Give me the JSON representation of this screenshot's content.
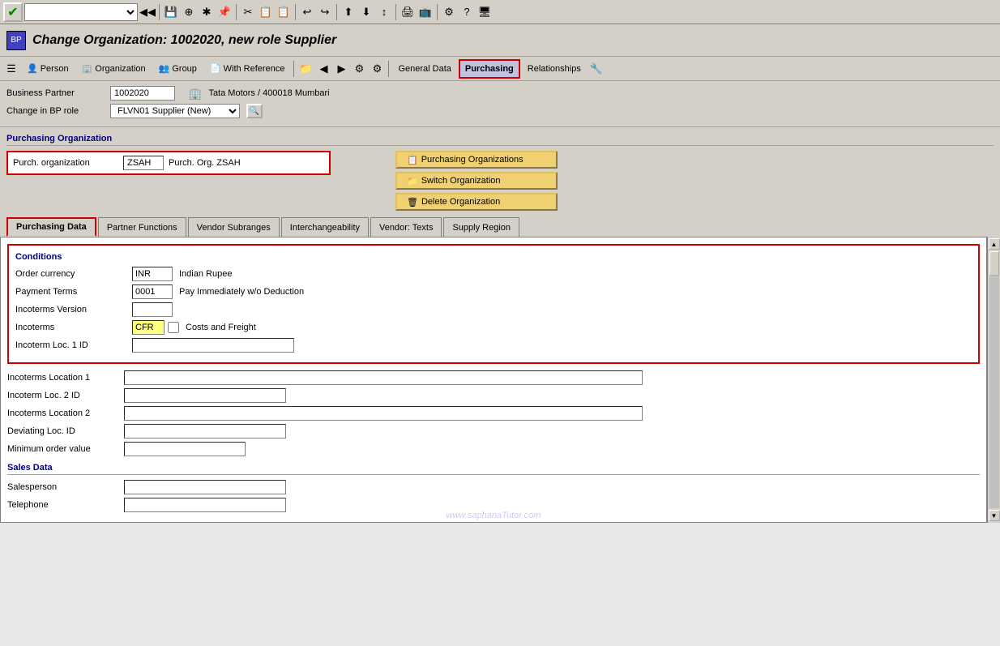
{
  "toolbar": {
    "select_placeholder": "",
    "icons": [
      "◀◀",
      "💾",
      "◀",
      "▶",
      "⊕",
      "✂",
      "📋",
      "📋",
      "↩",
      "↪",
      "📎",
      "📎",
      "⬆",
      "⬇",
      "↕",
      "🖨",
      "📺",
      "⚙",
      "?",
      "🖥"
    ]
  },
  "title": {
    "text": "Change Organization: 1002020, new role Supplier",
    "icon": "BP"
  },
  "nav": {
    "buttons": [
      {
        "label": "Person",
        "icon": "👤",
        "active": false
      },
      {
        "label": "Organization",
        "icon": "🏢",
        "active": false
      },
      {
        "label": "Group",
        "icon": "👥",
        "active": false
      },
      {
        "label": "With Reference",
        "icon": "📄",
        "active": false
      },
      {
        "label": "",
        "icon": "📁",
        "active": false
      },
      {
        "label": "",
        "icon": "◀",
        "active": false
      },
      {
        "label": "",
        "icon": "▶",
        "active": false
      },
      {
        "label": "",
        "icon": "⚙",
        "active": false
      },
      {
        "label": "",
        "icon": "⚙",
        "active": false
      },
      {
        "label": "General Data",
        "icon": "",
        "active": false
      },
      {
        "label": "Purchasing",
        "icon": "",
        "active": true
      },
      {
        "label": "Relationships",
        "icon": "",
        "active": false
      },
      {
        "label": "",
        "icon": "🔧",
        "active": false
      }
    ]
  },
  "business_partner": {
    "label": "Business Partner",
    "value": "1002020",
    "company_icon": "🏢",
    "company_name": "Tata Motors / 400018 Mumbari",
    "change_in_bp_role_label": "Change in BP role",
    "role_value": "FLVN01 Supplier (New)",
    "lookup_icon": "🔍"
  },
  "purchasing_organization": {
    "section_title": "Purchasing Organization",
    "field_label": "Purch. organization",
    "code": "ZSAH",
    "description": "Purch. Org. ZSAH",
    "buttons": [
      {
        "label": "Purchasing Organizations",
        "icon": "📋"
      },
      {
        "label": "Switch Organization",
        "icon": "📁"
      },
      {
        "label": "Delete Organization",
        "icon": "🗑"
      }
    ]
  },
  "tabs": [
    {
      "label": "Purchasing Data",
      "active": true
    },
    {
      "label": "Partner Functions",
      "active": false
    },
    {
      "label": "Vendor Subranges",
      "active": false
    },
    {
      "label": "Interchangeability",
      "active": false
    },
    {
      "label": "Vendor: Texts",
      "active": false
    },
    {
      "label": "Supply Region",
      "active": false
    }
  ],
  "conditions": {
    "title": "Conditions",
    "order_currency_label": "Order currency",
    "order_currency_value": "INR",
    "order_currency_text": "Indian Rupee",
    "payment_terms_label": "Payment Terms",
    "payment_terms_value": "0001",
    "payment_terms_text": "Pay Immediately w/o Deduction",
    "incoterms_version_label": "Incoterms Version",
    "incoterms_version_value": "",
    "incoterms_label": "Incoterms",
    "incoterms_value": "CFR",
    "incoterms_text": "Costs and Freight",
    "incoterm_loc1_id_label": "Incoterm Loc. 1 ID",
    "incoterm_loc1_id_value": ""
  },
  "other_fields": [
    {
      "label": "Incoterms Location 1",
      "value": "",
      "wide": true
    },
    {
      "label": "Incoterm Loc. 2 ID",
      "value": "",
      "medium": true
    },
    {
      "label": "Incoterms Location 2",
      "value": "",
      "wide": true
    },
    {
      "label": "Deviating Loc. ID",
      "value": "",
      "medium": true
    },
    {
      "label": "Minimum order value",
      "value": "",
      "small": true
    }
  ],
  "sales_data": {
    "title": "Sales Data",
    "salesperson_label": "Salesperson",
    "salesperson_value": "",
    "telephone_label": "Telephone",
    "telephone_value": ""
  },
  "watermark": "www.saphanaTutor.com"
}
